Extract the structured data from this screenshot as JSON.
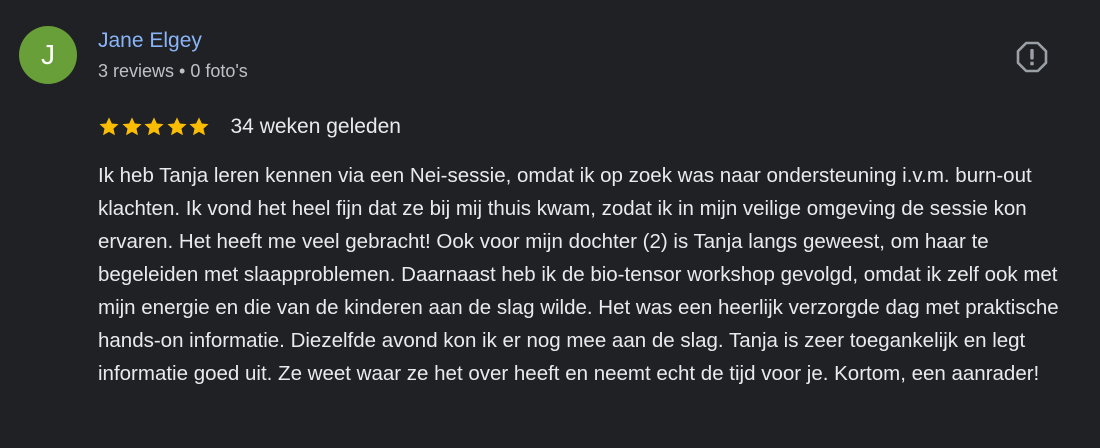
{
  "review": {
    "avatar_initial": "J",
    "reviewer_name": "Jane Elgey",
    "reviewer_meta": "3 reviews • 0 foto's",
    "rating": 5,
    "rating_max": 5,
    "date": "34 weken geleden",
    "text": "Ik heb Tanja leren kennen via een Nei-sessie, omdat ik op zoek was naar ondersteuning i.v.m. burn-out klachten. Ik vond het heel fijn dat ze bij mij thuis kwam, zodat ik in mijn veilige omgeving de sessie kon ervaren. Het heeft me veel gebracht! Ook voor mijn dochter (2) is Tanja langs geweest, om haar te begeleiden met slaapproblemen. Daarnaast heb ik de bio-tensor workshop gevolgd, omdat ik zelf ook met mijn energie en die van de kinderen aan de slag wilde. Het was een heerlijk verzorgde dag met praktische hands-on informatie. Diezelfde avond kon ik er nog mee aan de slag. Tanja is zeer toegankelijk en legt informatie goed uit. Ze weet waar ze het over heeft en neemt echt de tijd voor je. Kortom, een aanrader!"
  },
  "icons": {
    "flag": "report-flag-icon",
    "star": "star-icon"
  },
  "colors": {
    "background": "#202124",
    "avatar": "#689f38",
    "name_link": "#8ab4f8",
    "star": "#fbbc04",
    "text": "#e8eaed",
    "meta": "#bdc1c6",
    "icon": "#9aa0a6"
  }
}
